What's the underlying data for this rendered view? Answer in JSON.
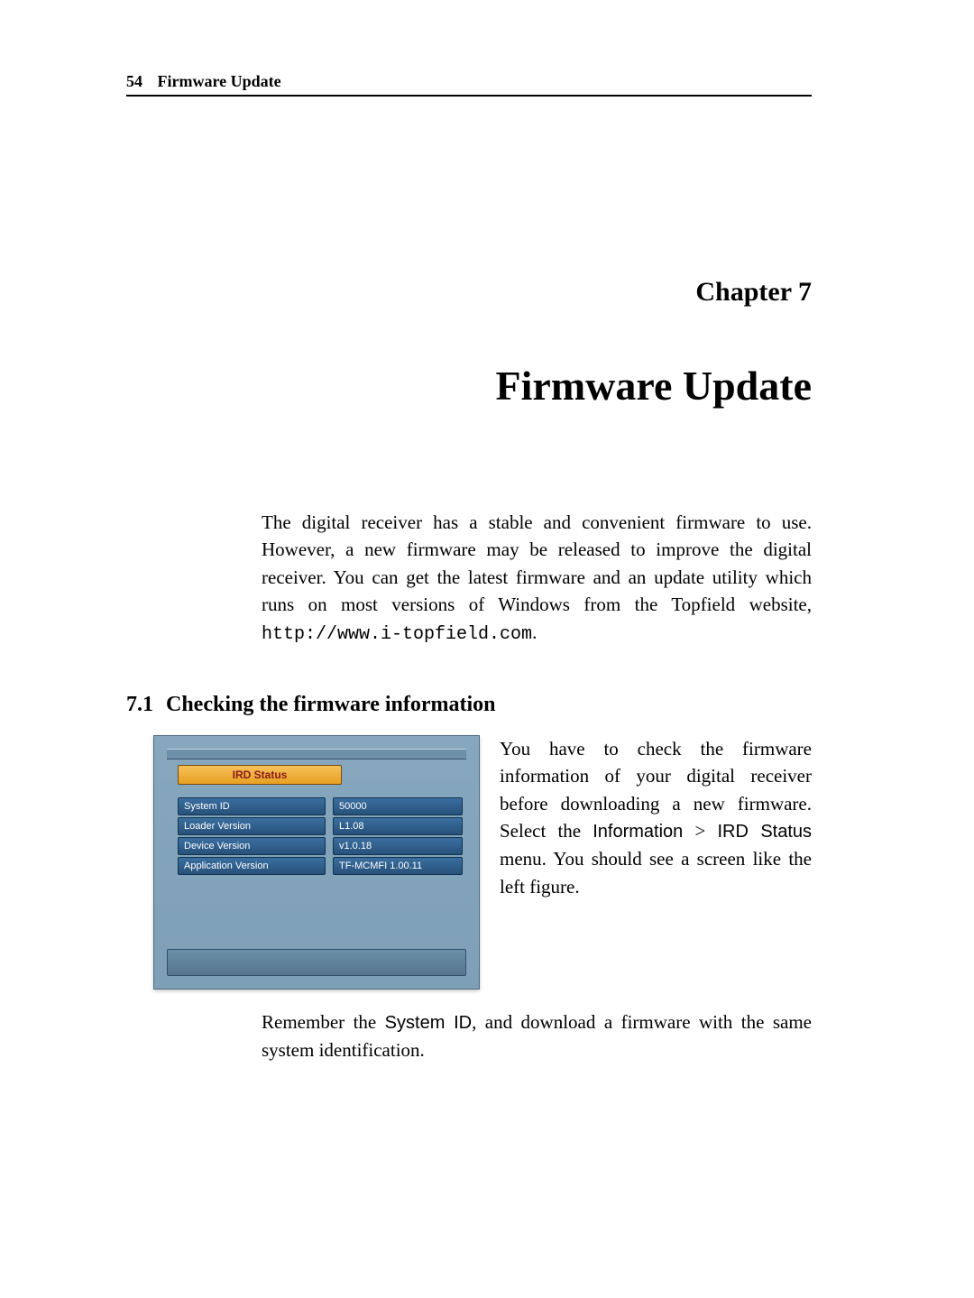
{
  "header": {
    "page_number": "54",
    "running_title": "Firmware Update"
  },
  "chapter": {
    "label": "Chapter 7",
    "title": "Firmware Update"
  },
  "intro": {
    "text_before_link": "The digital receiver has a stable and convenient firmware to use. However, a new firmware may be released to improve the digital receiver. You can get the latest firmware and an update utility which runs on most versions of Windows from the Topfield website, ",
    "link": "http://www.i-topfield.com",
    "text_after_link": "."
  },
  "section": {
    "number": "7.1",
    "title": "Checking the firmware information"
  },
  "screenshot": {
    "title": "IRD Status",
    "rows": [
      {
        "label": "System ID",
        "value": "50000"
      },
      {
        "label": "Loader Version",
        "value": "L1.08"
      },
      {
        "label": "Device Version",
        "value": "v1.0.18"
      },
      {
        "label": "Application Version",
        "value": "TF-MCMFI 1.00.11"
      }
    ]
  },
  "side_text": {
    "p1a": "You have to check the firmware information of your digital receiver before downloading a new firmware. Select the ",
    "menu1": "Information",
    "gt": " > ",
    "menu2": "IRD Status",
    "p1b": " menu. You should see a screen like the left figure."
  },
  "closing": {
    "a": "Remember the ",
    "sysid": "System ID",
    "b": ", and download a firmware with the same system identification."
  }
}
